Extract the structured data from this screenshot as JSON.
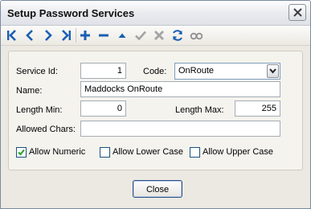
{
  "window": {
    "title": "Setup Password Services"
  },
  "toolbar": {
    "icons": [
      "first-record-icon",
      "previous-record-icon",
      "next-record-icon",
      "last-record-icon",
      "add-icon",
      "remove-icon",
      "move-up-icon",
      "confirm-icon",
      "cancel-icon",
      "refresh-icon",
      "view-icon"
    ]
  },
  "form": {
    "service_id": {
      "label": "Service Id:",
      "value": "1"
    },
    "code": {
      "label": "Code:",
      "value": "OnRoute"
    },
    "name": {
      "label": "Name:",
      "value": "Maddocks OnRoute"
    },
    "length_min": {
      "label": "Length Min:",
      "value": "0"
    },
    "length_max": {
      "label": "Length Max:",
      "value": "255"
    },
    "allowed_chars": {
      "label": "Allowed Chars:",
      "value": ""
    },
    "allow_numeric": {
      "label": "Allow Numeric",
      "checked": true
    },
    "allow_lower": {
      "label": "Allow Lower Case",
      "checked": false
    },
    "allow_upper": {
      "label": "Allow Upper Case",
      "checked": false
    }
  },
  "footer": {
    "close_label": "Close"
  },
  "colors": {
    "nav_blue": "#1a5fb4",
    "disabled_gray": "#a0a0a0",
    "accent_border": "#2b4f82"
  }
}
